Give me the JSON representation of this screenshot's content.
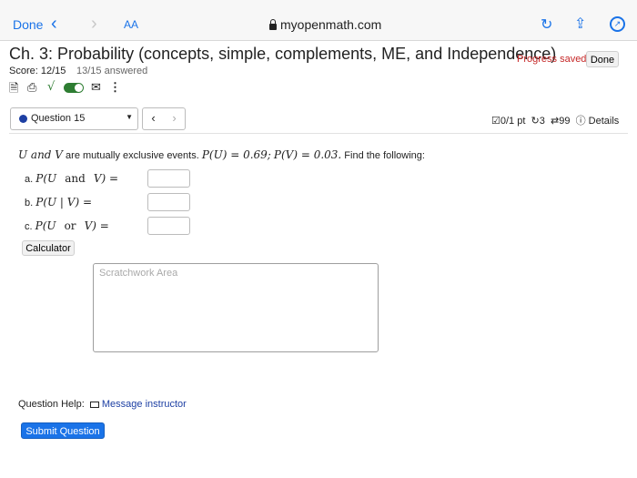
{
  "browser": {
    "done_label": "Done",
    "aa_label": "AA",
    "url": "myopenmath.com"
  },
  "header": {
    "title": "Ch. 3: Probability (concepts, simple, complements, ME, and Independence)",
    "progress_text": "Progress saved",
    "done_label": "Done",
    "score": "Score: 12/15",
    "answered": "13/15 answered"
  },
  "question_nav": {
    "selected_question": "Question 15",
    "prev_glyph": "‹",
    "next_glyph": "›",
    "points": "0/1 pt",
    "retries": "3",
    "attempts": "99",
    "details_label": "Details"
  },
  "question": {
    "intro_vars": "U and V",
    "intro_text": "are mutually exclusive events.",
    "pu": "P(U) = 0.69;",
    "pv": "P(V) = 0.03.",
    "intro_tail": "Find the following:",
    "parts": [
      {
        "letter": "a.",
        "pre": "P(U",
        "word": "and",
        "post": "V) ="
      },
      {
        "letter": "b.",
        "pre": "P(U | V) =",
        "word": "",
        "post": ""
      },
      {
        "letter": "c.",
        "pre": "P(U",
        "word": "or",
        "post": "V) ="
      }
    ]
  },
  "calculator_label": "Calculator",
  "scratch_placeholder": "Scratchwork Area",
  "help": {
    "label": "Question Help:",
    "message_label": "Message instructor"
  },
  "submit_label": "Submit Question",
  "colors": {
    "link": "#1a73e8",
    "progress": "#c62828",
    "toggle_on": "#2e7d32",
    "question_dot": "#1d3fa3"
  }
}
